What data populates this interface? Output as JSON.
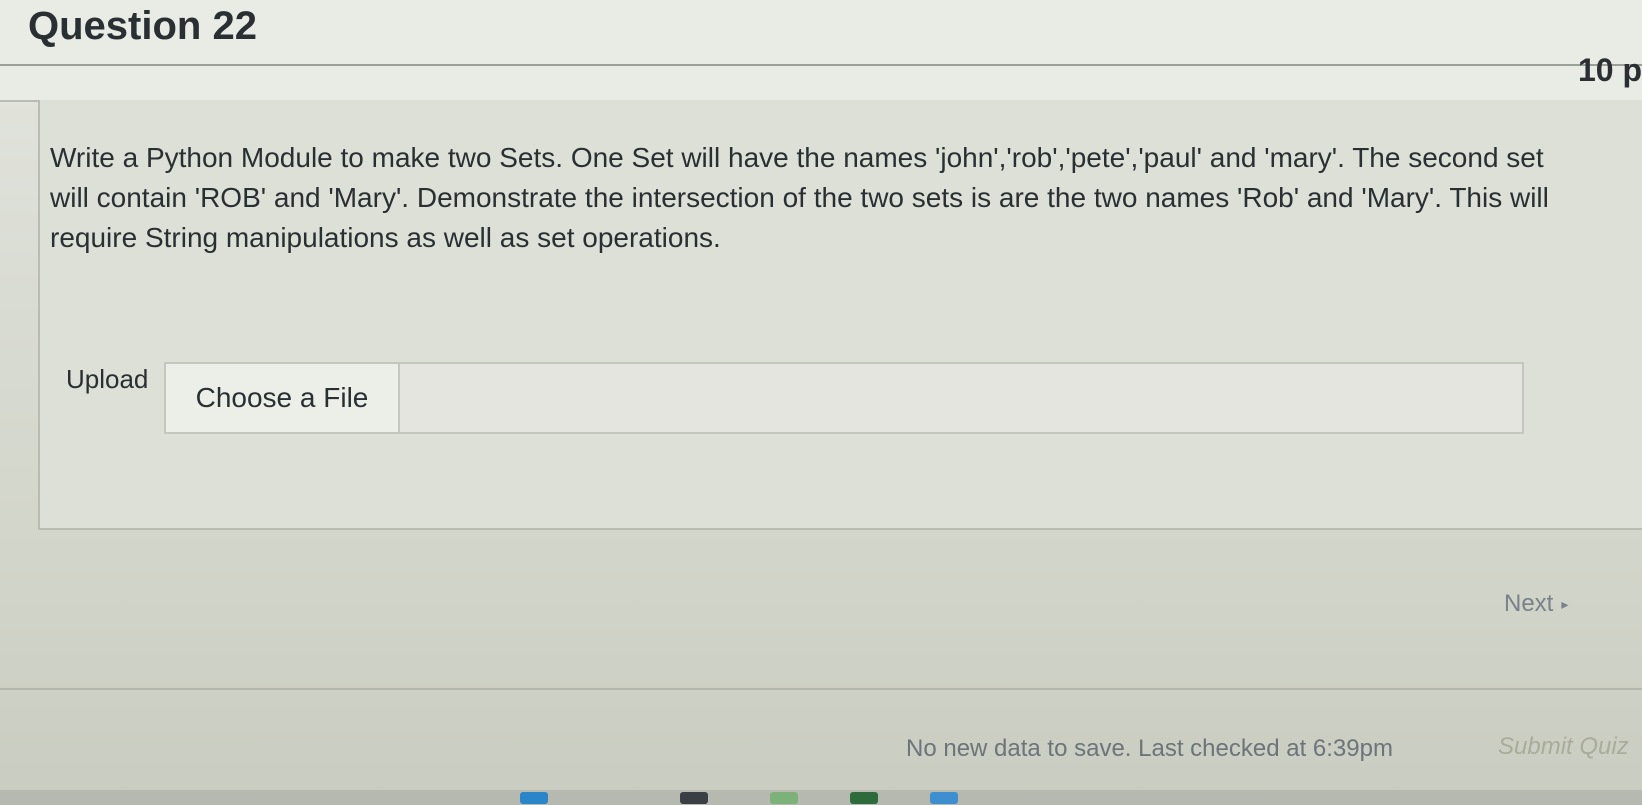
{
  "question": {
    "title": "Question 22",
    "points": "10 p",
    "text": "Write a Python Module to make two Sets.  One Set will have the names 'john','rob','pete','paul' and 'mary'.  The second set will contain 'ROB' and 'Mary'.  Demonstrate the intersection of the two sets is are the two names 'Rob' and 'Mary'.  This will require String manipulations as well as set operations."
  },
  "upload": {
    "label": "Upload",
    "choose_button": "Choose a File"
  },
  "navigation": {
    "next_label": "Next"
  },
  "footer": {
    "status": "No new data to save. Last checked at 6:39pm",
    "submit_label": "Submit Quiz"
  },
  "taskbar": {
    "icons": [
      "taskbar-app-icon",
      "taskbar-app-icon",
      "taskbar-app-icon",
      "taskbar-app-icon",
      "taskbar-app-icon"
    ]
  }
}
